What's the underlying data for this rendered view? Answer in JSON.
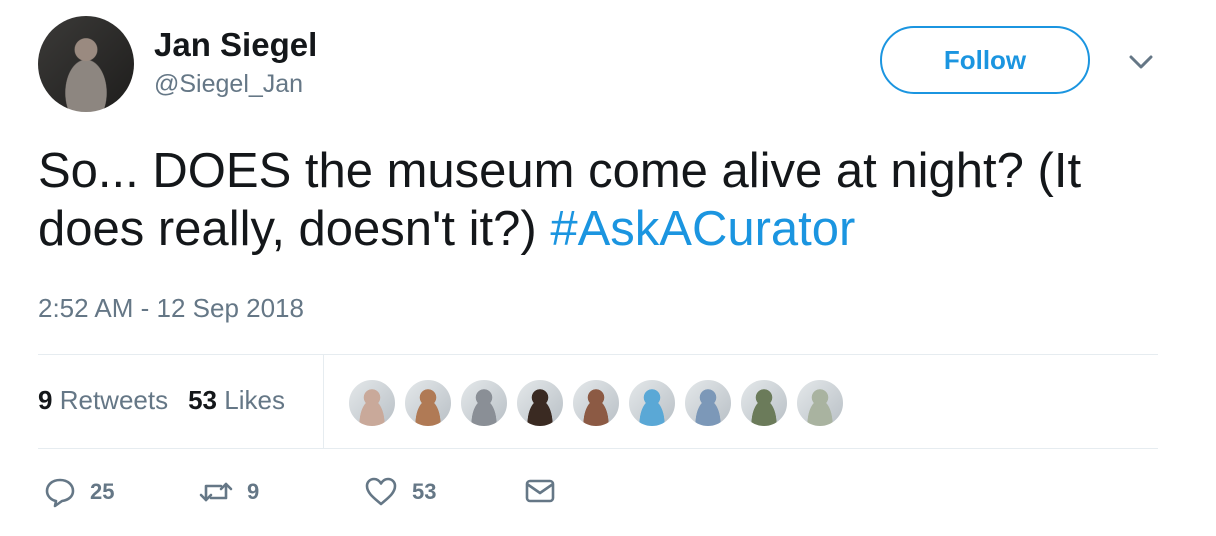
{
  "author": {
    "name": "Jan Siegel",
    "handle": "@Siegel_Jan"
  },
  "follow_label": "Follow",
  "tweet": {
    "text": "So... DOES the museum come alive at night? (It does really, doesn't it?)",
    "hashtag": "#AskACurator"
  },
  "timestamp": "2:52 AM - 12 Sep 2018",
  "stats": {
    "retweets_count": "9",
    "retweets_label": "Retweets",
    "likes_count": "53",
    "likes_label": "Likes"
  },
  "likers": [
    {
      "icon": "liker-avatar-1",
      "color": "#c9a99a"
    },
    {
      "icon": "liker-avatar-2",
      "color": "#b07a55"
    },
    {
      "icon": "liker-avatar-3",
      "color": "#8a8f96"
    },
    {
      "icon": "liker-avatar-4",
      "color": "#3a2a22"
    },
    {
      "icon": "liker-avatar-5",
      "color": "#8c5a44"
    },
    {
      "icon": "liker-avatar-6",
      "color": "#5aa8d6"
    },
    {
      "icon": "liker-avatar-7",
      "color": "#7c98b8"
    },
    {
      "icon": "liker-avatar-8",
      "color": "#6b7b5a"
    },
    {
      "icon": "liker-avatar-9",
      "color": "#a9b3a0"
    }
  ],
  "actions": {
    "replies": "25",
    "retweets": "9",
    "likes": "53"
  },
  "colors": {
    "accent": "#1b95e0",
    "secondary_text": "#657786",
    "primary_text": "#14171a"
  }
}
